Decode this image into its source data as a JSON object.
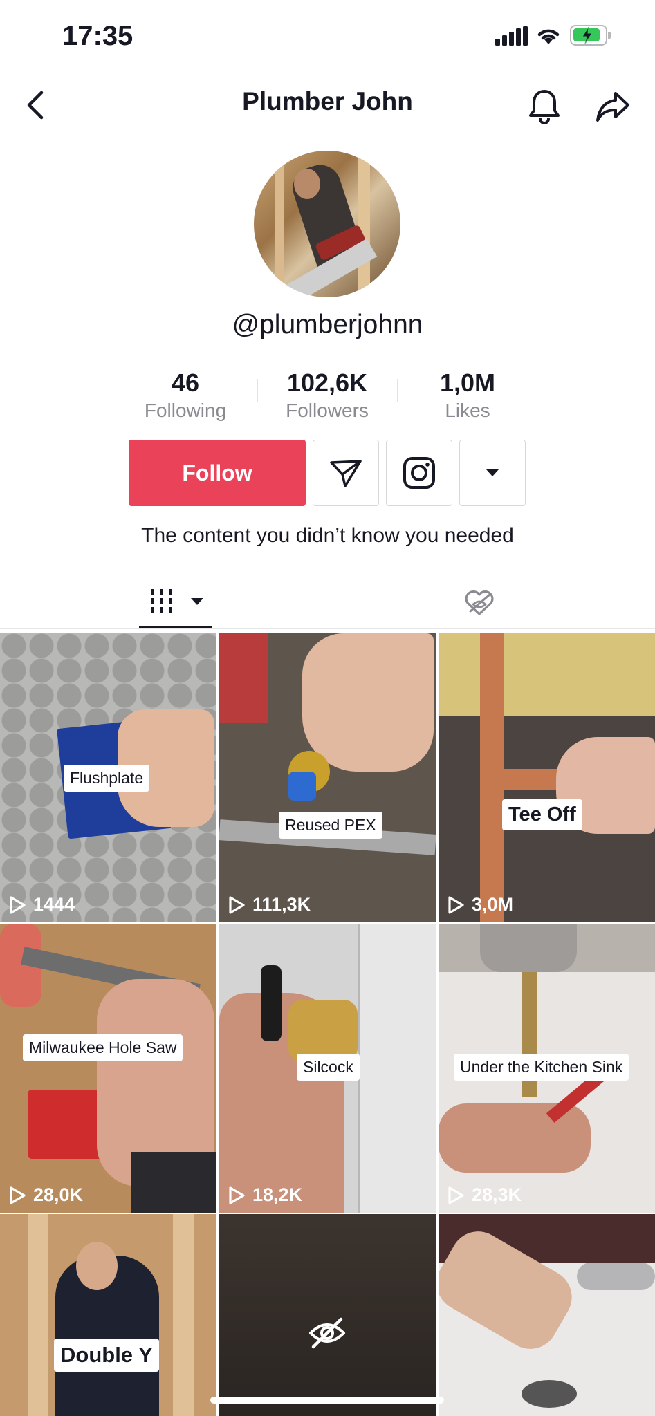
{
  "status_bar": {
    "time": "17:35"
  },
  "nav": {
    "title": "Plumber John",
    "icons": [
      "back-arrow-icon",
      "bell-icon",
      "share-icon"
    ]
  },
  "profile": {
    "username": "@plumberjohnn",
    "stats": [
      {
        "value": "46",
        "label": "Following"
      },
      {
        "value": "102,6K",
        "label": "Followers"
      },
      {
        "value": "1,0M",
        "label": "Likes"
      }
    ],
    "follow_label": "Follow",
    "action_icons": [
      "send-message-icon",
      "instagram-icon",
      "dropdown-caret-icon"
    ],
    "bio": "The content you didn’t know you needed"
  },
  "tabs": [
    {
      "icon": "grid-videos-icon",
      "active": true
    },
    {
      "icon": "hidden-liked-icon",
      "active": false
    }
  ],
  "colors": {
    "accent": "#ea4359",
    "text": "#161823",
    "muted": "#8a8b91"
  },
  "videos": [
    {
      "caption": "Flushplate",
      "views": "1444"
    },
    {
      "caption": "Reused PEX",
      "views": "111,3K"
    },
    {
      "caption": "Tee Off",
      "views": "3,0M"
    },
    {
      "caption": "Milwaukee Hole Saw",
      "views": "28,0K"
    },
    {
      "caption": "Silcock",
      "views": "18,2K"
    },
    {
      "caption": "Under the Kitchen Sink",
      "views": "28,3K"
    },
    {
      "caption": "Double Y",
      "views": ""
    },
    {
      "caption": "",
      "views": "",
      "hidden": true
    },
    {
      "caption": "",
      "views": ""
    }
  ]
}
